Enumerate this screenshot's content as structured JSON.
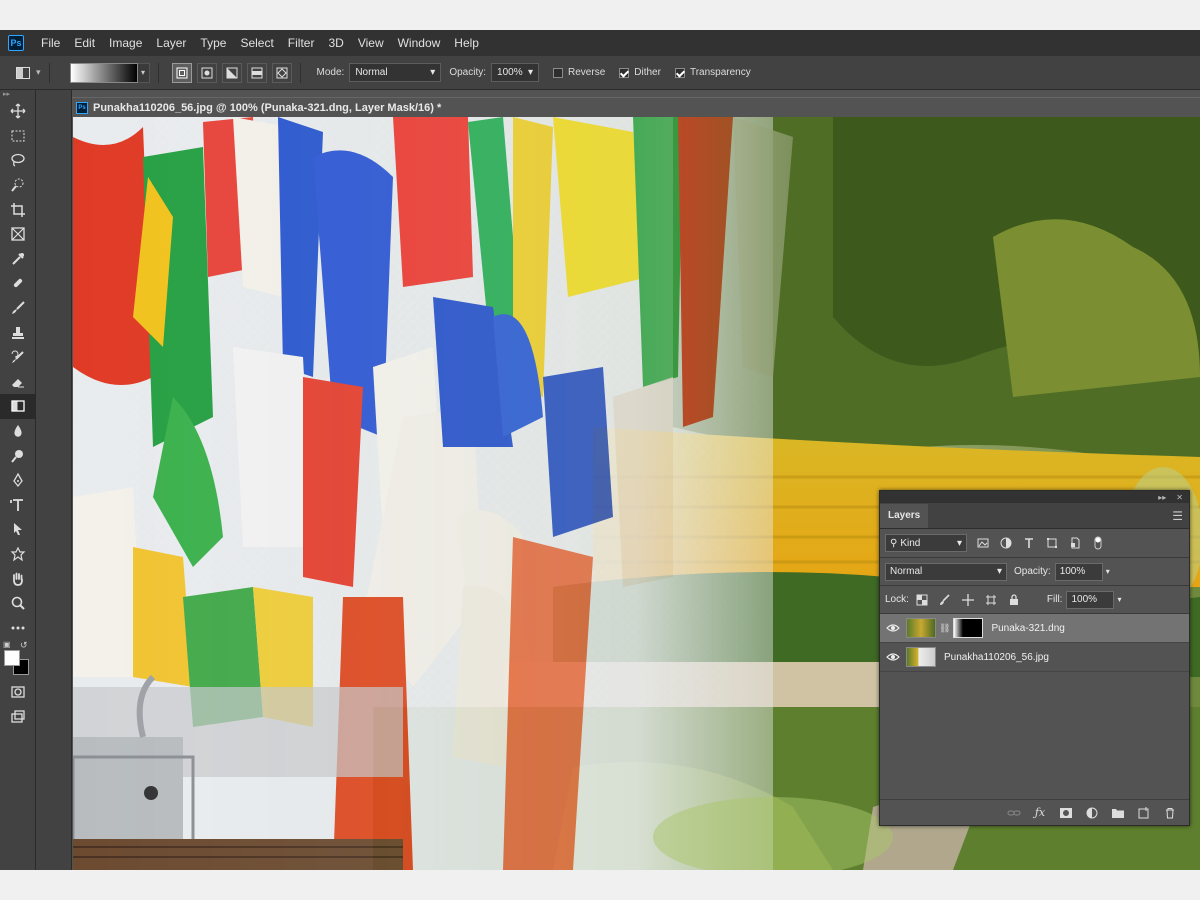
{
  "menubar": {
    "logo": "Ps",
    "items": [
      "File",
      "Edit",
      "Image",
      "Layer",
      "Type",
      "Select",
      "Filter",
      "3D",
      "View",
      "Window",
      "Help"
    ]
  },
  "options": {
    "mode_label": "Mode:",
    "mode_value": "Normal",
    "opacity_label": "Opacity:",
    "opacity_value": "100%",
    "reverse_label": "Reverse",
    "reverse_checked": false,
    "dither_label": "Dither",
    "dither_checked": true,
    "transparency_label": "Transparency",
    "transparency_checked": true
  },
  "document": {
    "tab_title": "Punakha110206_56.jpg @ 100% (Punaka-321.dng, Layer Mask/16) *"
  },
  "colors": {
    "foreground": "#ffffff",
    "background": "#000000",
    "accent": "#31a8ff"
  },
  "layers_panel": {
    "tab_label": "Layers",
    "filter_value": "Kind",
    "blend_mode": "Normal",
    "opacity_label": "Opacity:",
    "opacity_value": "100%",
    "lock_label": "Lock:",
    "fill_label": "Fill:",
    "fill_value": "100%",
    "layers": [
      {
        "name": "Punaka-321.dng",
        "visible": true,
        "selected": true,
        "has_mask": true
      },
      {
        "name": "Punakha110206_56.jpg",
        "visible": true,
        "selected": false,
        "has_mask": false
      }
    ]
  }
}
